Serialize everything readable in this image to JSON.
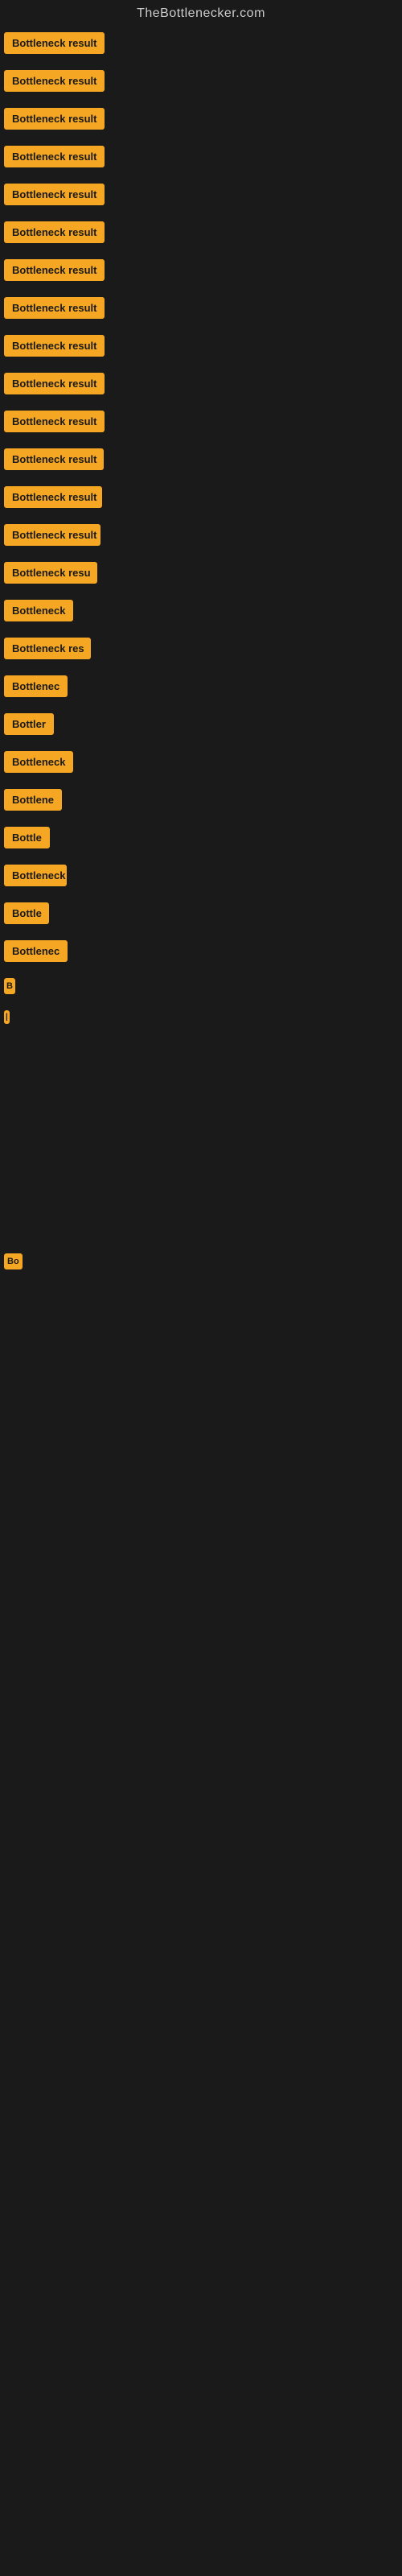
{
  "site": {
    "title": "TheBottlenecker.com"
  },
  "rows": [
    {
      "id": 1,
      "label": "Bottleneck result",
      "visible_label": "Bottleneck result"
    },
    {
      "id": 2,
      "label": "Bottleneck result",
      "visible_label": "Bottleneck result"
    },
    {
      "id": 3,
      "label": "Bottleneck result",
      "visible_label": "Bottleneck result"
    },
    {
      "id": 4,
      "label": "Bottleneck result",
      "visible_label": "Bottleneck result"
    },
    {
      "id": 5,
      "label": "Bottleneck result",
      "visible_label": "Bottleneck result"
    },
    {
      "id": 6,
      "label": "Bottleneck result",
      "visible_label": "Bottleneck result"
    },
    {
      "id": 7,
      "label": "Bottleneck result",
      "visible_label": "Bottleneck result"
    },
    {
      "id": 8,
      "label": "Bottleneck result",
      "visible_label": "Bottleneck result"
    },
    {
      "id": 9,
      "label": "Bottleneck result",
      "visible_label": "Bottleneck result"
    },
    {
      "id": 10,
      "label": "Bottleneck result",
      "visible_label": "Bottleneck result"
    },
    {
      "id": 11,
      "label": "Bottleneck result",
      "visible_label": "Bottleneck result"
    },
    {
      "id": 12,
      "label": "Bottleneck result",
      "visible_label": "Bottleneck result"
    },
    {
      "id": 13,
      "label": "Bottleneck result",
      "visible_label": "Bottleneck result"
    },
    {
      "id": 14,
      "label": "Bottleneck result",
      "visible_label": "Bottleneck result"
    },
    {
      "id": 15,
      "label": "Bottleneck resu",
      "visible_label": "Bottleneck resu"
    },
    {
      "id": 16,
      "label": "Bottleneck",
      "visible_label": "Bottleneck"
    },
    {
      "id": 17,
      "label": "Bottleneck res",
      "visible_label": "Bottleneck res"
    },
    {
      "id": 18,
      "label": "Bottlenec",
      "visible_label": "Bottlenec"
    },
    {
      "id": 19,
      "label": "Bottler",
      "visible_label": "Bottler"
    },
    {
      "id": 20,
      "label": "Bottleneck",
      "visible_label": "Bottleneck"
    },
    {
      "id": 21,
      "label": "Bottlene",
      "visible_label": "Bottlene"
    },
    {
      "id": 22,
      "label": "Bottle",
      "visible_label": "Bottle"
    },
    {
      "id": 23,
      "label": "Bottleneck r",
      "visible_label": "Bottleneck r"
    },
    {
      "id": 24,
      "label": "Bottle",
      "visible_label": "Bottle"
    },
    {
      "id": 25,
      "label": "Bottlenec",
      "visible_label": "Bottlenec"
    },
    {
      "id": 26,
      "label": "B",
      "visible_label": "B"
    },
    {
      "id": 27,
      "label": "|",
      "visible_label": "|"
    }
  ],
  "bottom_row": {
    "label": "Bo",
    "visible_label": "Bo"
  }
}
